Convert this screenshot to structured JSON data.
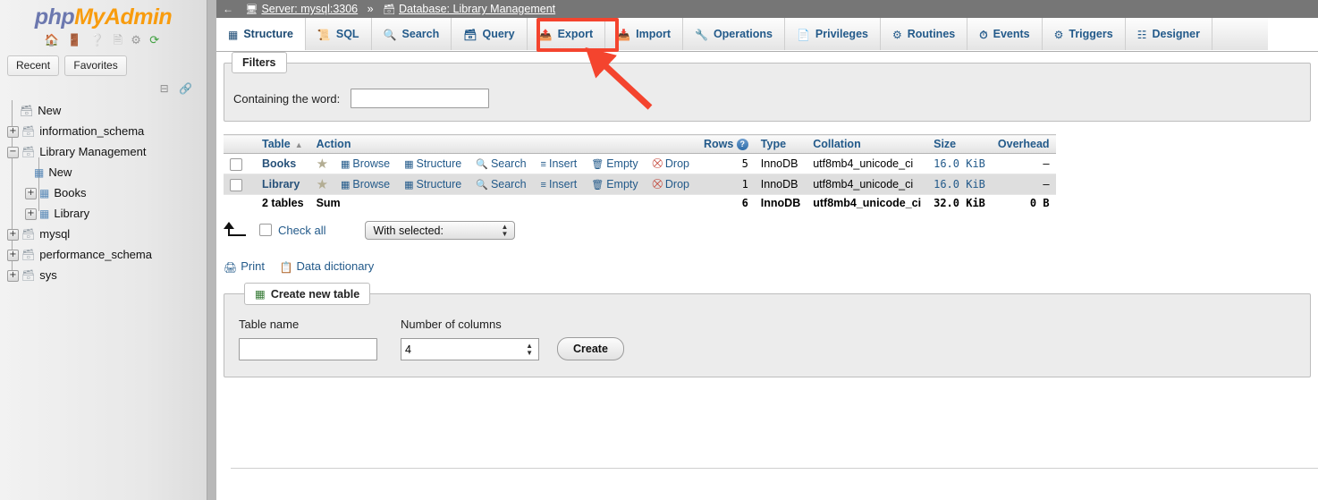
{
  "branding": {
    "logo_php": "php",
    "logo_myadmin": "MyAdmin",
    "header_icons": [
      "home-icon",
      "logout-icon",
      "help-icon",
      "docs-icon",
      "settings-icon",
      "reload-icon"
    ]
  },
  "sidebar": {
    "tabs": [
      {
        "label": "Recent",
        "name": "recent-tab"
      },
      {
        "label": "Favorites",
        "name": "favorites-tab"
      }
    ],
    "collapse_icons": [
      "collapse-all-icon",
      "link-with-main-panel-icon"
    ],
    "tree": [
      {
        "label": "New",
        "level": 0,
        "toggle": "",
        "icon": "new-database-icon"
      },
      {
        "label": "information_schema",
        "level": 0,
        "toggle": "+",
        "icon": "database-icon"
      },
      {
        "label": "Library Management",
        "level": 0,
        "toggle": "−",
        "icon": "database-icon"
      },
      {
        "label": "New",
        "level": 1,
        "toggle": "",
        "icon": "new-table-icon"
      },
      {
        "label": "Books",
        "level": 1,
        "toggle": "+",
        "icon": "table-icon"
      },
      {
        "label": "Library",
        "level": 1,
        "toggle": "+",
        "icon": "table-icon"
      },
      {
        "label": "mysql",
        "level": 0,
        "toggle": "+",
        "icon": "database-icon"
      },
      {
        "label": "performance_schema",
        "level": 0,
        "toggle": "+",
        "icon": "database-icon"
      },
      {
        "label": "sys",
        "level": 0,
        "toggle": "+",
        "icon": "database-icon"
      }
    ]
  },
  "breadcrumb": {
    "back_arrow": "←",
    "server_label": "Server: mysql:3306",
    "separator": "»",
    "database_label": "Database: Library Management"
  },
  "tabs": [
    {
      "label": "Structure",
      "icon": "structure-icon",
      "active": true
    },
    {
      "label": "SQL",
      "icon": "sql-icon",
      "active": false
    },
    {
      "label": "Search",
      "icon": "search-icon",
      "active": false
    },
    {
      "label": "Query",
      "icon": "query-icon",
      "active": false
    },
    {
      "label": "Export",
      "icon": "export-icon",
      "active": false
    },
    {
      "label": "Import",
      "icon": "import-icon",
      "active": false
    },
    {
      "label": "Operations",
      "icon": "operations-icon",
      "active": false
    },
    {
      "label": "Privileges",
      "icon": "privileges-icon",
      "active": false
    },
    {
      "label": "Routines",
      "icon": "routines-icon",
      "active": false
    },
    {
      "label": "Events",
      "icon": "events-icon",
      "active": false
    },
    {
      "label": "Triggers",
      "icon": "triggers-icon",
      "active": false
    },
    {
      "label": "Designer",
      "icon": "designer-icon",
      "active": false
    }
  ],
  "filters": {
    "legend": "Filters",
    "containing_label": "Containing the word:",
    "containing_value": "",
    "containing_placeholder": ""
  },
  "tables_table": {
    "headers": {
      "table": "Table",
      "action": "Action",
      "rows": "Rows",
      "rows_help": "?",
      "type": "Type",
      "collation": "Collation",
      "size": "Size",
      "overhead": "Overhead"
    },
    "sort_indicator": "▲",
    "action_labels": {
      "browse": "Browse",
      "structure": "Structure",
      "search": "Search",
      "insert": "Insert",
      "empty": "Empty",
      "drop": "Drop"
    },
    "rows": [
      {
        "name": "Books",
        "rows": "5",
        "type": "InnoDB",
        "collation": "utf8mb4_unicode_ci",
        "size": "16.0 KiB",
        "overhead": "–"
      },
      {
        "name": "Library",
        "rows": "1",
        "type": "InnoDB",
        "collation": "utf8mb4_unicode_ci",
        "size": "16.0 KiB",
        "overhead": "–"
      }
    ],
    "summary": {
      "count": "2 tables",
      "label": "Sum",
      "rows": "6",
      "type": "InnoDB",
      "collation": "utf8mb4_unicode_ci",
      "size": "32.0 KiB",
      "overhead": "0 B"
    }
  },
  "bulk": {
    "check_all": "Check all",
    "with_selected": "With selected:"
  },
  "footer_links": {
    "print": "Print",
    "data_dictionary": "Data dictionary"
  },
  "create_table": {
    "legend": "Create new table",
    "table_name_label": "Table name",
    "table_name_value": "",
    "columns_label": "Number of columns",
    "columns_value": "4",
    "create_button": "Create"
  },
  "annotation": {
    "highlight_target": "Export",
    "highlight_color": "#f4442e",
    "arrow_color": "#f4442e"
  }
}
